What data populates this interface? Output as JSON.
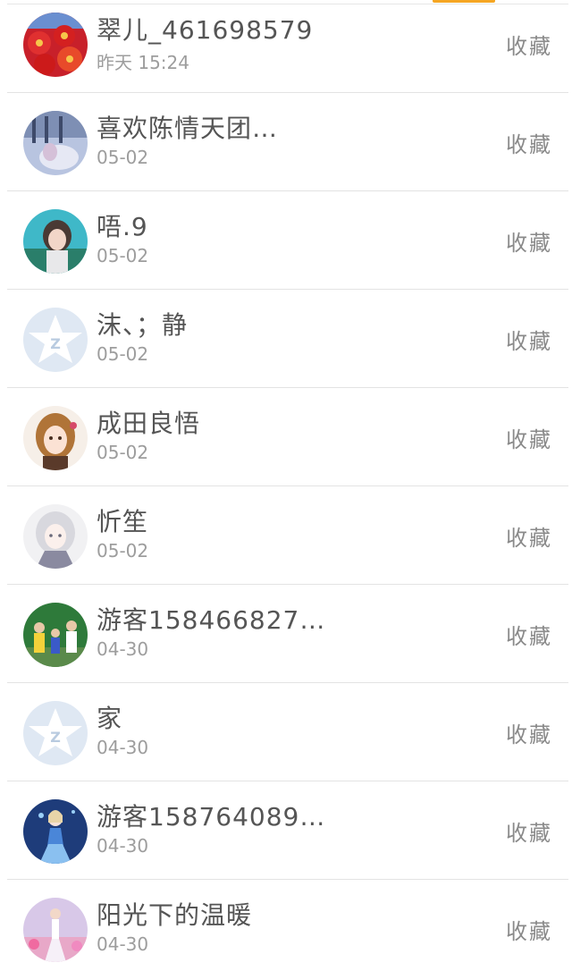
{
  "items": [
    {
      "name": "翠儿_461698579",
      "time": "昨天 15:24",
      "action": "收藏",
      "avatar": "avatar-photo-red-lanterns"
    },
    {
      "name": "喜欢陈情天团…",
      "time": "05-02",
      "action": "收藏",
      "avatar": "avatar-photo-blue-scene"
    },
    {
      "name": "唔.9",
      "time": "05-02",
      "action": "收藏",
      "avatar": "avatar-photo-girl"
    },
    {
      "name": "沫、；静",
      "time": "05-02",
      "action": "收藏",
      "avatar": "default-qq-avatar"
    },
    {
      "name": "成田良悟",
      "time": "05-02",
      "action": "收藏",
      "avatar": "avatar-anime-girl"
    },
    {
      "name": "忻笙",
      "time": "05-02",
      "action": "收藏",
      "avatar": "avatar-anime-white-hair"
    },
    {
      "name": "游客158466827…",
      "time": "04-30",
      "action": "收藏",
      "avatar": "avatar-photo-family"
    },
    {
      "name": "家",
      "time": "04-30",
      "action": "收藏",
      "avatar": "default-qq-avatar"
    },
    {
      "name": "游客158764089…",
      "time": "04-30",
      "action": "收藏",
      "avatar": "avatar-anime-blue-dress"
    },
    {
      "name": "阳光下的温暖",
      "time": "04-30",
      "action": "收藏",
      "avatar": "avatar-photo-flowers"
    }
  ]
}
